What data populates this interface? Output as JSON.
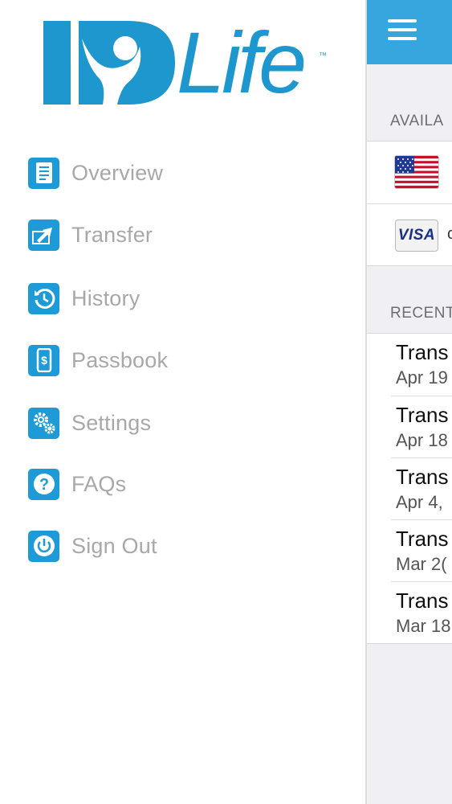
{
  "logo": {
    "text": "IDLife",
    "trademark": "™"
  },
  "menu": [
    {
      "id": "overview",
      "label": "Overview",
      "icon": "document-icon"
    },
    {
      "id": "transfer",
      "label": "Transfer",
      "icon": "transfer-icon"
    },
    {
      "id": "history",
      "label": "History",
      "icon": "clock-icon"
    },
    {
      "id": "passbook",
      "label": "Passbook",
      "icon": "phone-dollar-icon"
    },
    {
      "id": "settings",
      "label": "Settings",
      "icon": "gears-icon"
    },
    {
      "id": "faqs",
      "label": "FAQs",
      "icon": "question-icon"
    },
    {
      "id": "signout",
      "label": "Sign Out",
      "icon": "power-icon"
    }
  ],
  "main": {
    "available_header": "AVAILA",
    "accounts": [
      {
        "icon": "us-flag-icon",
        "trail": ""
      },
      {
        "icon": "visa-card-icon",
        "card_brand": "VISA",
        "trail": "c"
      }
    ],
    "recent_header": "RECENT",
    "transactions": [
      {
        "title": "Trans",
        "date": "Apr 19"
      },
      {
        "title": "Trans",
        "date": "Apr 18"
      },
      {
        "title": "Trans",
        "date": "Apr 4,"
      },
      {
        "title": "Trans",
        "date": "Mar 2("
      },
      {
        "title": "Trans",
        "date": "Mar 18"
      }
    ]
  },
  "colors": {
    "brand": "#1d97cd",
    "topbar": "#37a6df",
    "menu_text": "#a8a8a8",
    "background": "#efeff4"
  }
}
